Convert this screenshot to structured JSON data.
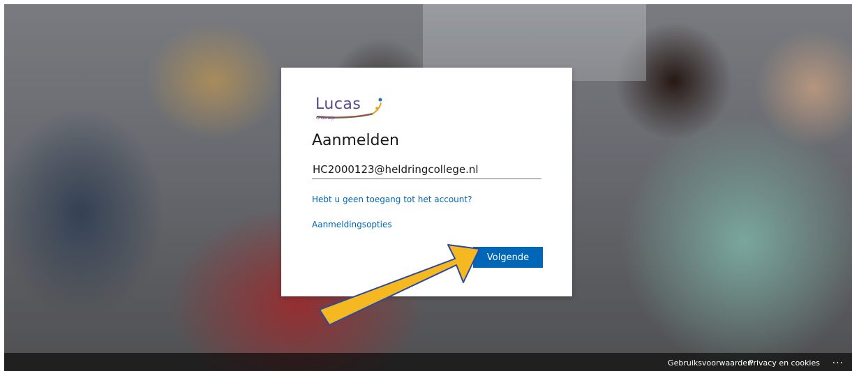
{
  "logo": {
    "text": "Lucas",
    "subtext": "Onderwijs"
  },
  "signin": {
    "title": "Aanmelden",
    "email_value": "HC2000123@heldringcollege.nl",
    "no_access_link": "Hebt u geen toegang tot het account?",
    "options_link": "Aanmeldingsopties",
    "next_button": "Volgende"
  },
  "footer": {
    "terms": "Gebruiksvoorwaarden",
    "privacy": "Privacy en cookies",
    "more": "..."
  },
  "colors": {
    "accent": "#0067b8",
    "annotation_arrow": "#f5b820"
  },
  "icons": {
    "more": "ellipsis-icon",
    "annotation": "annotation-arrow-icon"
  }
}
